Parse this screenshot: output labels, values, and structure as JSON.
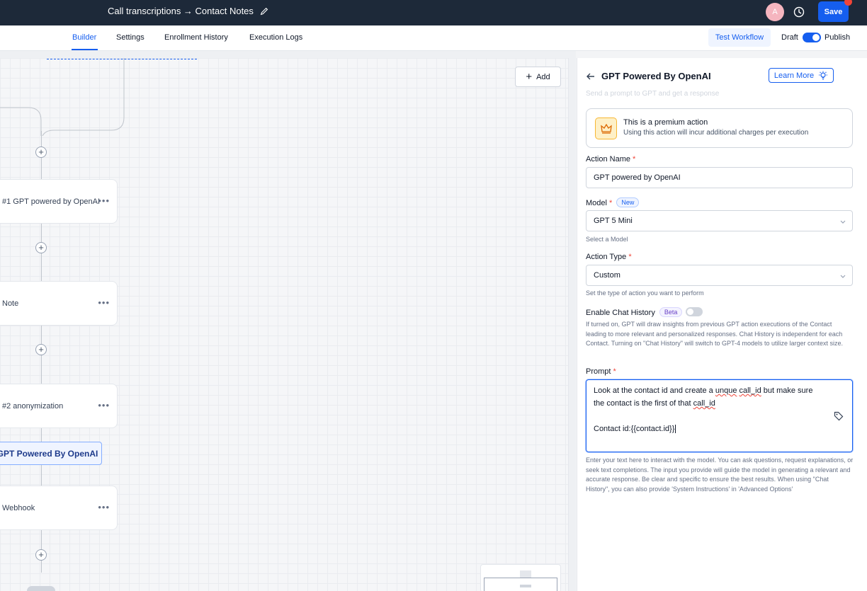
{
  "header": {
    "title": "Call transcriptions → Contact Notes",
    "avatar_initials": "A",
    "save_label": "Save"
  },
  "subnav": {
    "tabs": [
      {
        "label": "Builder",
        "active": true
      },
      {
        "label": "Settings"
      },
      {
        "label": "Enrollment History"
      },
      {
        "label": "Execution Logs"
      }
    ],
    "test_workflow_label": "Test Workflow",
    "draft_label": "Draft",
    "publish_label": "Publish"
  },
  "canvas": {
    "add_label": "Add",
    "nodes": [
      {
        "label": "#1 GPT powered by OpenAI"
      },
      {
        "label": "Note"
      },
      {
        "label": "#2 anonymization"
      },
      {
        "label": "Webhook"
      }
    ],
    "dragging_chip": "GPT Powered By OpenAI"
  },
  "panel": {
    "title": "GPT Powered By OpenAI",
    "learn_more_label": "Learn More",
    "subtitle": "Send a prompt to GPT and get a response",
    "premium": {
      "title": "This is a premium action",
      "description": "Using this action will incur additional charges per execution"
    },
    "action_name": {
      "label": "Action Name",
      "value": "GPT powered by OpenAI"
    },
    "model": {
      "label": "Model",
      "badge": "New",
      "value": "GPT 5 Mini",
      "help": "Select a Model"
    },
    "action_type": {
      "label": "Action Type",
      "value": "Custom",
      "help": "Set the type of action you want to perform"
    },
    "chat_history": {
      "label": "Enable Chat History",
      "badge": "Beta",
      "help": "If turned on, GPT will draw insights from previous GPT action executions of the Contact leading to more relevant and personalized responses. Chat History is independent for each Contact. Turning on \"Chat History\" will switch to GPT-4 models to utilize larger context size."
    },
    "prompt": {
      "label": "Prompt",
      "line1_a": "Look at the contact id and create a ",
      "line1_b": "unque",
      "line1_c": " ",
      "line1_d": "call_id",
      "line1_e": " but make sure",
      "line2_a": "the contact is the first of that ",
      "line2_b": "call_id",
      "line3": "Contact id:{{contact.id}}",
      "help": "Enter your text here to interact with the model. You can ask questions, request explanations, or seek text completions. The input you provide will guide the model in generating a relevant and accurate response. Be clear and specific to ensure the best results. When using \"Chat History\", you can also provide 'System Instructions' in 'Advanced Options'"
    }
  },
  "colors": {
    "topbar": "#1d2939",
    "accent": "#155eef",
    "notification": "#f04438"
  }
}
